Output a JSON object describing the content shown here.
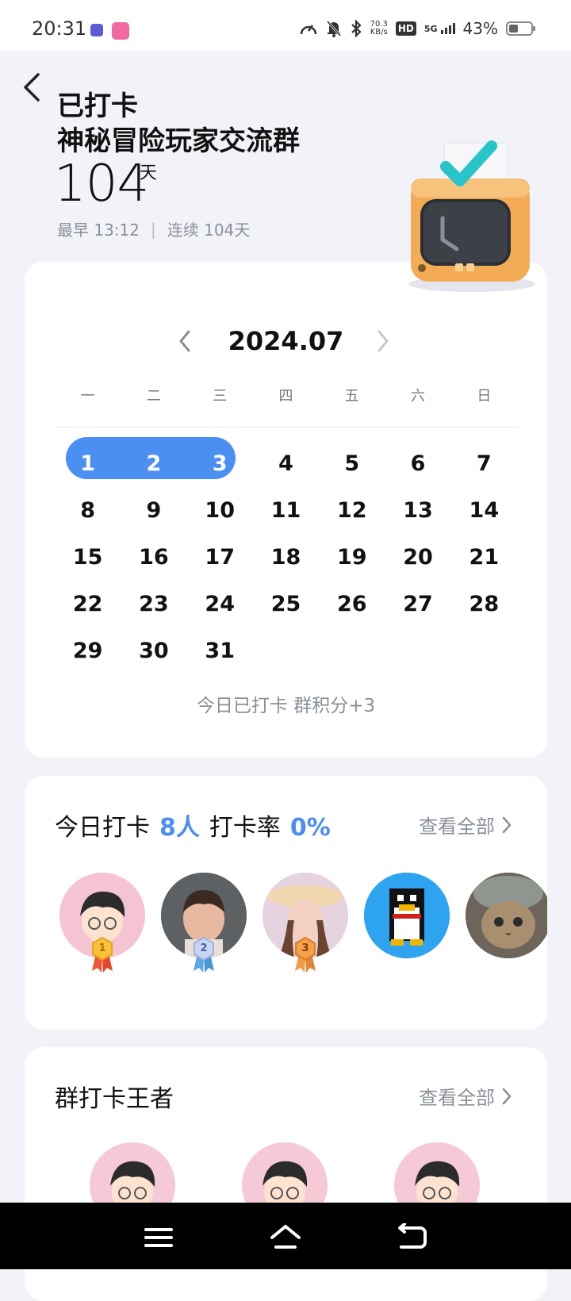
{
  "status_bar": {
    "time": "20:31",
    "net_speed_value": "70.3",
    "net_speed_unit": "KB/s",
    "hd": "HD",
    "signal": "5G",
    "battery": "43%",
    "battery_level": 0.43,
    "icons": [
      "app-badge-icon",
      "app-badge-pink-icon",
      "speedometer-icon",
      "bell-muted-icon",
      "bluetooth-icon",
      "signal-icon",
      "battery-icon"
    ]
  },
  "header": {
    "title_line1": "已打卡",
    "title_line2": "神秘冒险玩家交流群",
    "days": "104",
    "days_unit": "天",
    "earliest": "最早 13:12",
    "separator": "|",
    "streak": "连续 104天"
  },
  "calendar": {
    "month": "2024.07",
    "weekdays": [
      "一",
      "二",
      "三",
      "四",
      "五",
      "六",
      "日"
    ],
    "checked_days": [
      1,
      2,
      3
    ],
    "footer": "今日已打卡   群积分+3",
    "accent": "#4c8ff2"
  },
  "today": {
    "label": "今日打卡",
    "count": "8人",
    "rate_label": "打卡率",
    "rate": "0%",
    "view_all": "查看全部",
    "medals": [
      "1",
      "2",
      "3"
    ]
  },
  "king": {
    "title": "群打卡王者",
    "view_all": "查看全部"
  }
}
